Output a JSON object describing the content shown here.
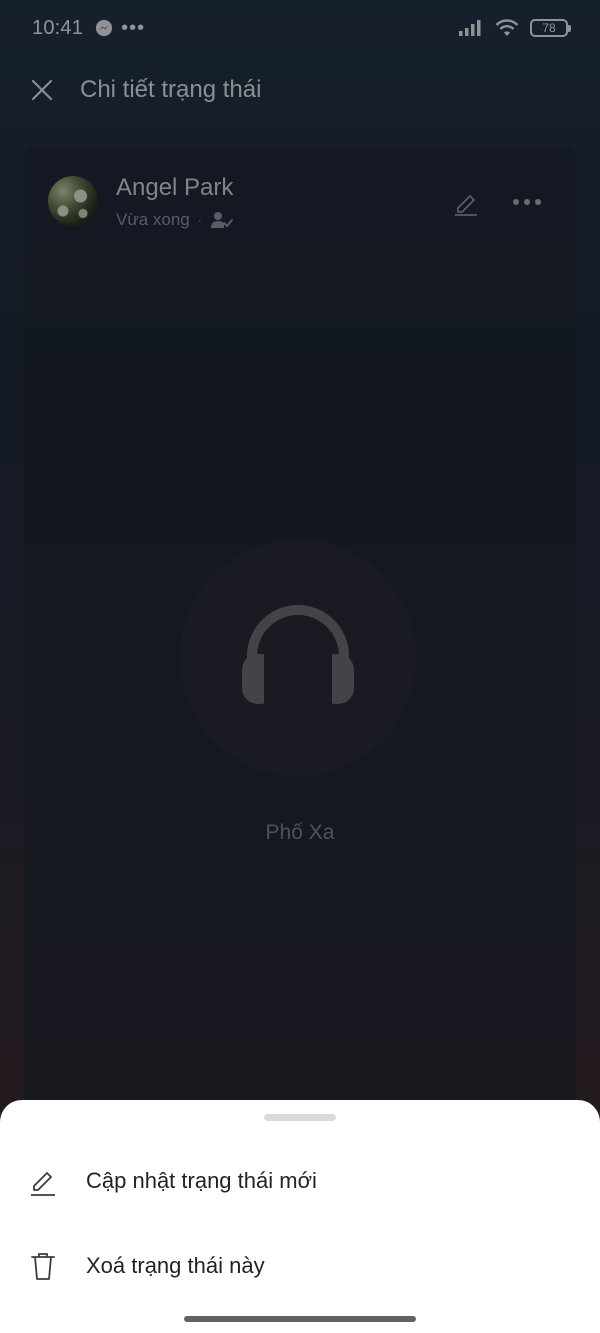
{
  "status_bar": {
    "time": "10:41",
    "more_indicator": "•••",
    "battery_level": "78",
    "icons": [
      "messenger-icon",
      "signal-icon",
      "wifi-icon",
      "battery-icon"
    ]
  },
  "header": {
    "title": "Chi tiết trạng thái",
    "close_icon": "close-icon"
  },
  "post": {
    "author_name": "Angel Park",
    "time_ago": "Vừa xong",
    "separator": "·",
    "privacy_icon": "friends-check-icon",
    "edit_icon": "pencil-icon",
    "more_icon": "more-dots-icon",
    "media_icon": "headphones-icon",
    "song_title": "Phố Xa"
  },
  "bottom_sheet": {
    "items": [
      {
        "label": "Cập nhật trạng thái mới",
        "icon": "pencil-icon"
      },
      {
        "label": "Xoá trạng thái này",
        "icon": "trash-icon"
      }
    ]
  },
  "colors": {
    "sheet_background": "#ffffff",
    "dimmed_overlay": "rgba(0,0,0,0.38)"
  }
}
